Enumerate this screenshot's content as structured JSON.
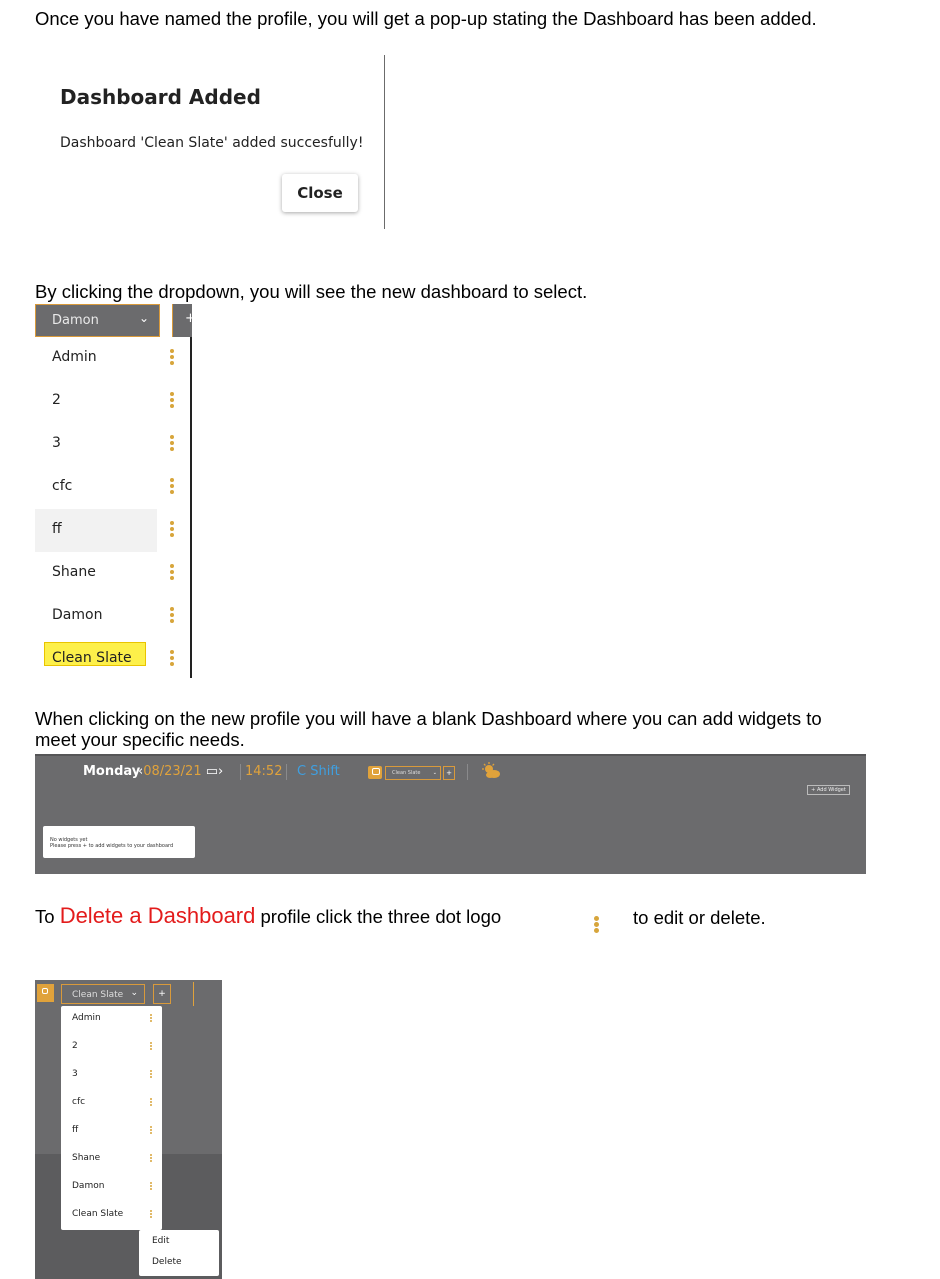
{
  "text": {
    "p1": "Once you have named the profile, you will get a pop-up stating the Dashboard has been added.",
    "p2": "By clicking the dropdown, you will see the new dashboard to select.",
    "p3": "When clicking on the new profile you will have a blank Dashboard where you can add widgets to meet your specific needs.",
    "p4_prefix": "To ",
    "p4_highlight": "Delete a Dashboard",
    "p4_mid": " profile click the three dot logo",
    "p4_suffix": "to edit or delete."
  },
  "modal": {
    "title": "Dashboard Added",
    "message": "Dashboard 'Clean Slate' added succesfully!",
    "close_label": "Close"
  },
  "dropdown": {
    "selected": "Damon",
    "chevron": "⌄",
    "plus": "+",
    "items": [
      "Admin",
      "2",
      "3",
      "cfc",
      "ff",
      "Shane",
      "Damon",
      "Clean Slate"
    ]
  },
  "dashboard_bar": {
    "day": "Monday",
    "date": "08/23/21",
    "time": "14:52",
    "shift": "C Shift",
    "selected": "Clean Slate",
    "plus": "+",
    "add_widget": "+ Add Widget",
    "empty_title": "No widgets yet",
    "empty_hint": "Please press + to add widgets to your dashboard"
  },
  "menu_shot": {
    "selected": "Clean Slate",
    "plus": "+",
    "items": [
      "Admin",
      "2",
      "3",
      "cfc",
      "ff",
      "Shane",
      "Damon",
      "Clean Slate"
    ],
    "actions": [
      "Edit",
      "Delete"
    ]
  },
  "colors": {
    "accent": "#e0a23b",
    "delete_text": "#e31b1b",
    "shift_blue": "#3f9fe0",
    "bar_bg": "#6b6b6d",
    "highlight": "#fdf04a"
  },
  "icons": [
    "chevron-down-icon",
    "calendar-icon",
    "lock-icon",
    "weather-icon",
    "three-dot-icon"
  ]
}
